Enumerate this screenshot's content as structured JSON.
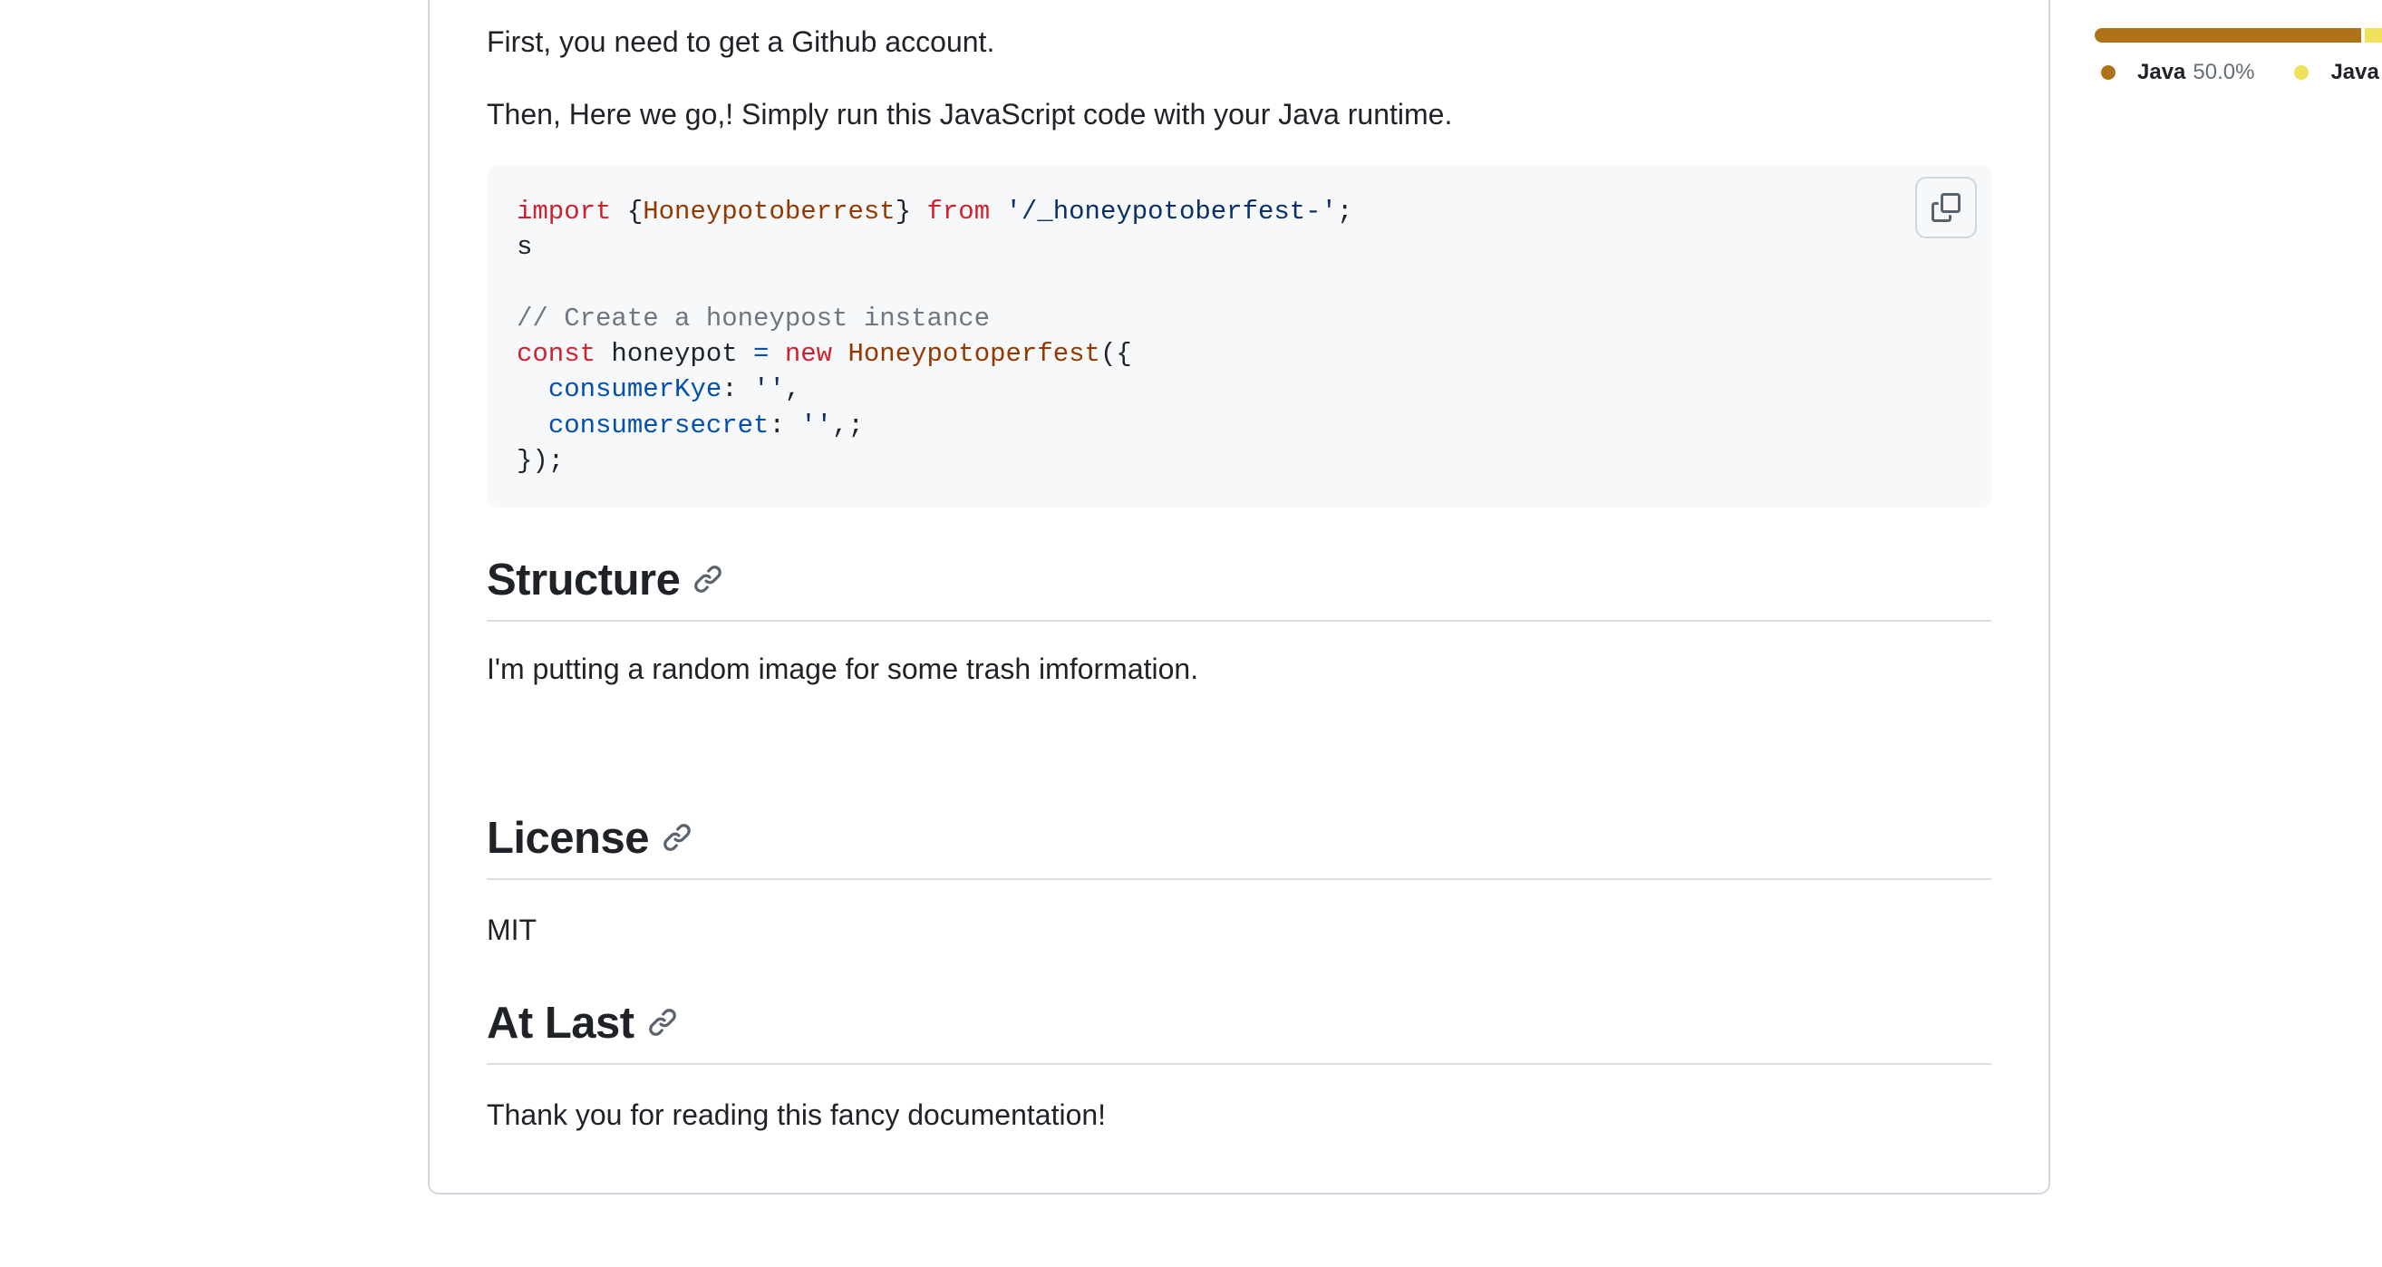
{
  "readme": {
    "intro_paragraph_1": "First, you need to get a Github account.",
    "intro_paragraph_2": "Then, Here we go,! Simply run this JavaScript code with your Java runtime.",
    "code_block": {
      "line1": {
        "kw_import": "import",
        "brace_open": " {",
        "class_name": "Honeypotoberrest",
        "brace_close": "} ",
        "kw_from": "from",
        "space": " ",
        "module": "'/_honeypotoberfest-'",
        "semi": ";"
      },
      "line2": "s",
      "line4": "// Create a honeypost instance",
      "line5": {
        "kw_const": "const",
        "var": " honeypot ",
        "op_eq": "=",
        "space": " ",
        "kw_new": "new",
        "space2": " ",
        "class": "Honeypotoperfest",
        "paren": "({"
      },
      "line6": {
        "indent": "  ",
        "prop": "consumerKye",
        "colon": ": ",
        "str": "''",
        "rest": ","
      },
      "line7": {
        "indent": "  ",
        "prop": "consumersecret",
        "colon": ": ",
        "str": "''",
        "rest": ",;"
      },
      "line8": "});",
      "copy_icon": "copy-icon"
    },
    "sections": [
      {
        "title": "Structure",
        "body": "I'm putting a random image for some trash imformation."
      },
      {
        "title": "License",
        "body": "MIT"
      },
      {
        "title": "At Last",
        "body": "Thank you for reading this fancy documentation!"
      }
    ],
    "heading_link_icon": "link-icon"
  },
  "sidebar": {
    "languages": [
      {
        "name": "Java",
        "percent": "50.0%",
        "color": "#b07219"
      },
      {
        "name": "Java",
        "color": "#f1e05a"
      }
    ]
  }
}
